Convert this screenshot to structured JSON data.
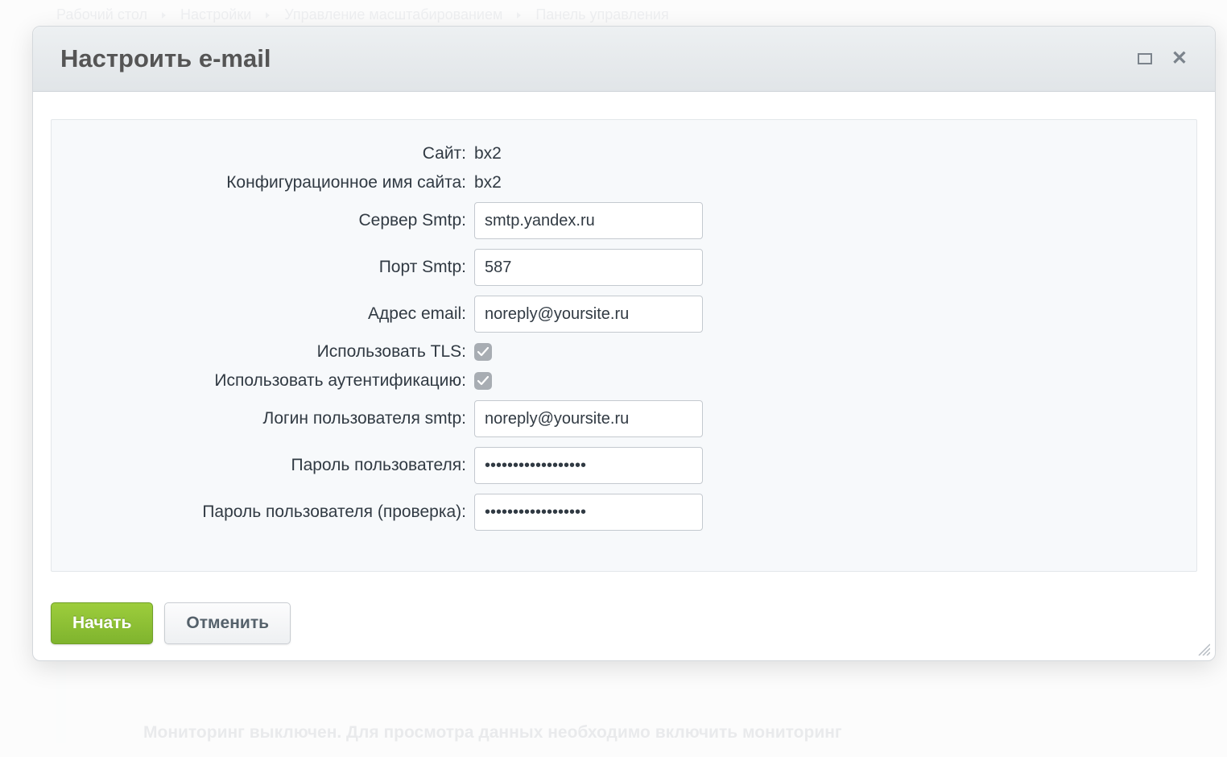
{
  "breadcrumb": {
    "items": [
      "Рабочий стол",
      "Настройки",
      "Управление масштабированием",
      "Панель управления"
    ]
  },
  "modal": {
    "title": "Настроить e-mail",
    "maximize_icon": "maximize-icon",
    "close_icon": "close-icon"
  },
  "form": {
    "site_label": "Сайт:",
    "site_value": "bx2",
    "config_name_label": "Конфигурационное имя сайта:",
    "config_name_value": "bx2",
    "smtp_server_label": "Сервер Smtp:",
    "smtp_server_value": "smtp.yandex.ru",
    "smtp_port_label": "Порт Smtp:",
    "smtp_port_value": "587",
    "email_label": "Адрес email:",
    "email_value": "noreply@yoursite.ru",
    "use_tls_label": "Использовать TLS:",
    "use_tls_checked": true,
    "use_auth_label": "Использовать аутентификацию:",
    "use_auth_checked": true,
    "smtp_login_label": "Логин пользователя smtp:",
    "smtp_login_value": "noreply@yoursite.ru",
    "password_label": "Пароль пользователя:",
    "password_value": "••••••••••••••••••",
    "password_confirm_label": "Пароль пользователя (проверка):",
    "password_confirm_value": "••••••••••••••••••"
  },
  "buttons": {
    "start": "Начать",
    "cancel": "Отменить"
  },
  "background": {
    "notice": "Мониторинг выключен. Для просмотра данных необходимо включить мониторинг"
  }
}
